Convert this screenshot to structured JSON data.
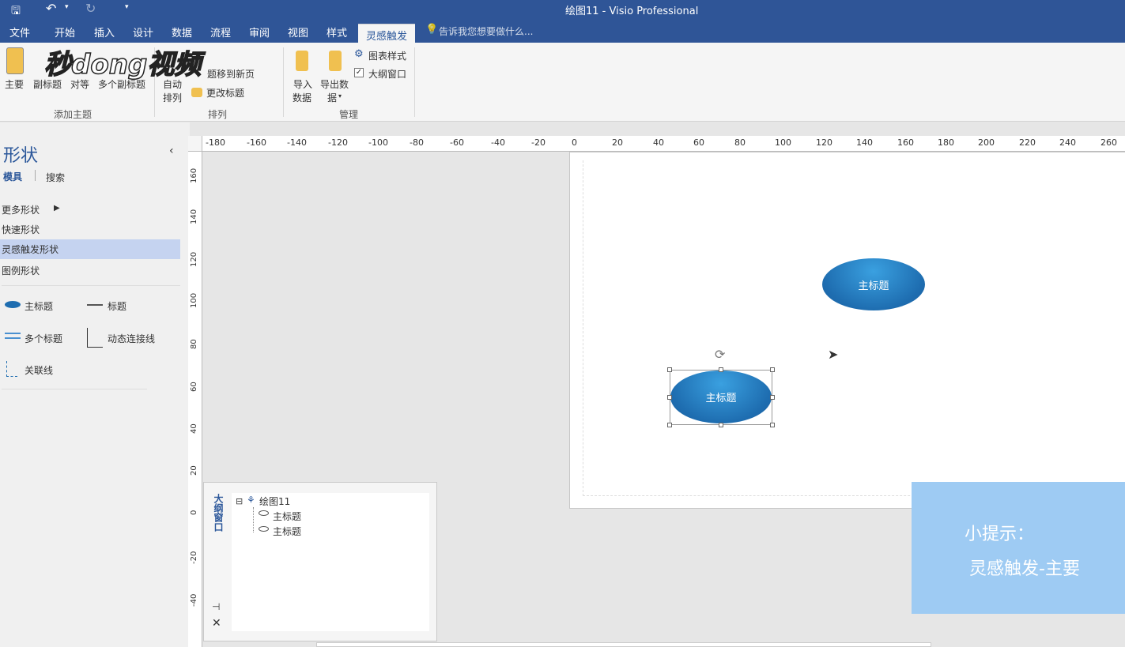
{
  "title_bar": {
    "title": "绘图11 - Visio Professional"
  },
  "tabs": [
    "文件",
    "开始",
    "插入",
    "设计",
    "数据",
    "流程",
    "审阅",
    "视图",
    "样式",
    "灵感触发"
  ],
  "tell_me": "告诉我您想要做什么...",
  "ribbon": {
    "add_topic": {
      "items": [
        "主要",
        "副标题",
        "对等",
        "多个副标题"
      ],
      "group_label": "添加主题"
    },
    "arrange": {
      "auto": "自动",
      "auto2": "排列",
      "move": "题移到新页",
      "change": "更改标题",
      "group_label": "排列"
    },
    "manage": {
      "import1": "导入",
      "import2": "数据",
      "export1": "导出数",
      "export2": "据",
      "chart_style": "图表样式",
      "outline_window": "大纲窗口",
      "group_label": "管理"
    }
  },
  "watermark": "秒dong视频",
  "shapes_panel": {
    "title": "形状",
    "tab_stencil": "模具",
    "tab_search": "搜索",
    "more_shapes": "更多形状",
    "quick_shapes": "快速形状",
    "brainstorm_shapes": "灵感触发形状",
    "legend_shapes": "图例形状",
    "main_topic": "主标题",
    "topic": "标题",
    "multi_topic": "多个标题",
    "dynamic_connector": "动态连接线",
    "relation_line": "关联线"
  },
  "ruler_top": [
    "-180",
    "-160",
    "-140",
    "-120",
    "-100",
    "-80",
    "-60",
    "-40",
    "-20",
    "0",
    "20",
    "40",
    "60",
    "80",
    "100",
    "120",
    "140",
    "160",
    "180",
    "200",
    "220",
    "240",
    "260"
  ],
  "ruler_left": [
    "160",
    "140",
    "120",
    "100",
    "80",
    "60",
    "40",
    "20",
    "0",
    "-20",
    "-40"
  ],
  "canvas": {
    "shape1": "主标题",
    "shape2": "主标题"
  },
  "outline_window": {
    "title": "大纲窗口",
    "root": "绘图11",
    "child1": "主标题",
    "child2": "主标题"
  },
  "tip": {
    "line1": "小提示：",
    "line2": "灵感触发-主要"
  },
  "colors": {
    "title_bar": "#2f5597",
    "accent": "#2b579a",
    "shape_fill": "#1e78c2",
    "tip_bg": "#9ecbf3"
  }
}
